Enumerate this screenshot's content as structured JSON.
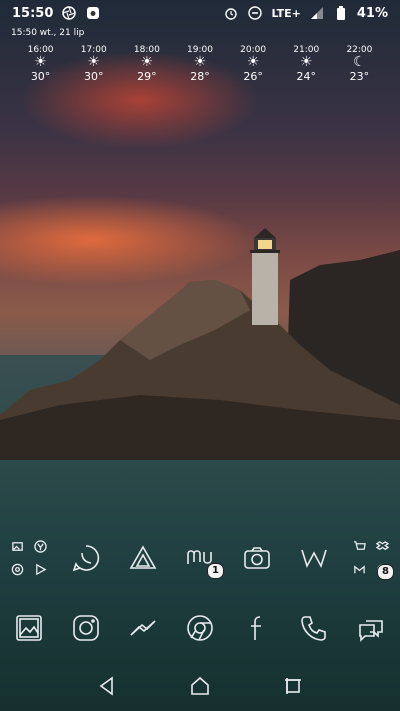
{
  "status_bar": {
    "time": "15:50",
    "network": "LTE+",
    "battery": "41%"
  },
  "date_line": "15:50  wt., 21 lip",
  "weather": [
    {
      "time": "16:00",
      "icon": "sun-icon",
      "temp": "30°"
    },
    {
      "time": "17:00",
      "icon": "sun-icon",
      "temp": "30°"
    },
    {
      "time": "18:00",
      "icon": "sun-icon",
      "temp": "29°"
    },
    {
      "time": "19:00",
      "icon": "sun-icon",
      "temp": "28°"
    },
    {
      "time": "20:00",
      "icon": "sun-icon",
      "temp": "26°"
    },
    {
      "time": "21:00",
      "icon": "sun-icon",
      "temp": "24°"
    },
    {
      "time": "22:00",
      "icon": "moon-icon",
      "temp": "23°"
    }
  ],
  "home_row_1": {
    "badges": {
      "mu": "1",
      "folder_right": "8"
    }
  }
}
